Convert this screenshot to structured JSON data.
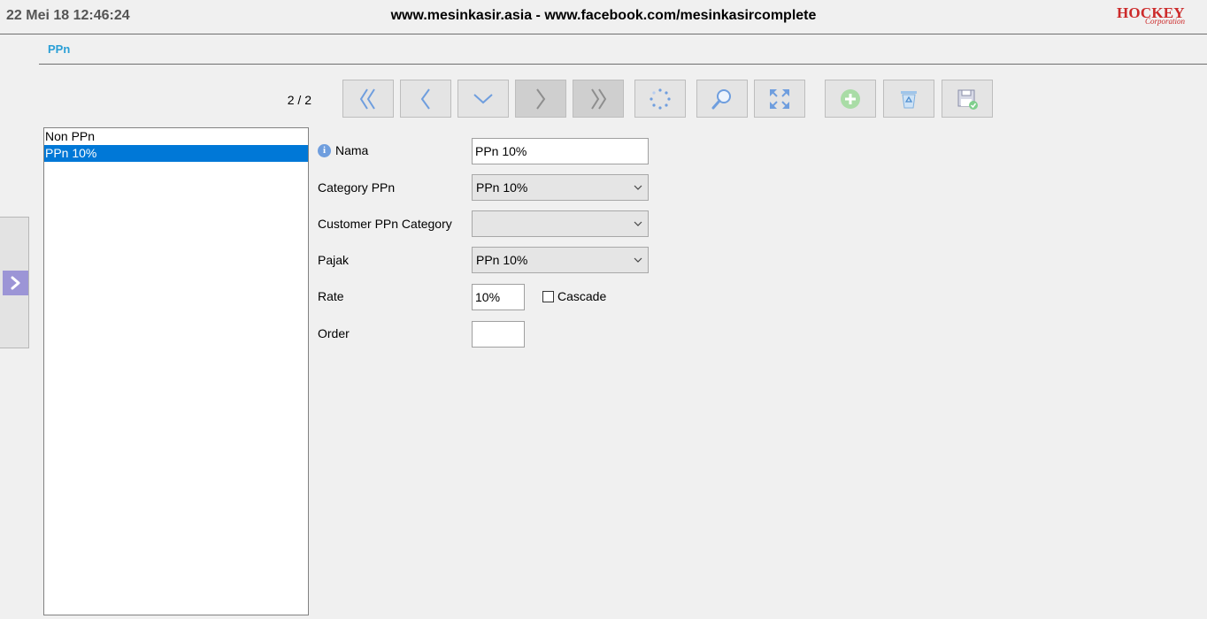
{
  "header": {
    "datetime": "22 Mei 18 12:46:24",
    "site": "www.mesinkasir.asia - www.facebook.com/mesinkasircomplete",
    "brand_name": "HOCKEY",
    "brand_sub": "Corporation"
  },
  "tab": {
    "title": "PPn"
  },
  "toolbar": {
    "record_counter": "2 / 2",
    "buttons": [
      {
        "name": "first-record",
        "icon": "double-chevron-left-icon",
        "enabled": true
      },
      {
        "name": "previous-record",
        "icon": "chevron-left-icon",
        "enabled": true
      },
      {
        "name": "next-down",
        "icon": "chevron-down-icon",
        "enabled": true
      },
      {
        "name": "next-record",
        "icon": "chevron-right-icon",
        "enabled": false
      },
      {
        "name": "last-record",
        "icon": "double-chevron-right-icon",
        "enabled": false
      },
      {
        "name": "refresh",
        "icon": "spinner-icon",
        "enabled": true
      },
      {
        "name": "search",
        "icon": "magnifier-icon",
        "enabled": true
      },
      {
        "name": "expand",
        "icon": "expand-arrows-icon",
        "enabled": true
      },
      {
        "name": "add",
        "icon": "plus-circle-icon",
        "enabled": true
      },
      {
        "name": "delete",
        "icon": "recycle-bin-icon",
        "enabled": true
      },
      {
        "name": "save",
        "icon": "floppy-disk-icon",
        "enabled": true
      }
    ]
  },
  "list": {
    "items": [
      "Non PPn",
      "PPn 10%"
    ],
    "selected_index": 1
  },
  "form": {
    "nama": {
      "label": "Nama",
      "value": "PPn 10%"
    },
    "category": {
      "label": "Category PPn",
      "value": "PPn 10%"
    },
    "customer_category": {
      "label": "Customer PPn Category",
      "value": ""
    },
    "pajak": {
      "label": "Pajak",
      "value": "PPn 10%"
    },
    "rate": {
      "label": "Rate",
      "value": "10%"
    },
    "cascade": {
      "label": "Cascade",
      "checked": false
    },
    "order": {
      "label": "Order",
      "value": ""
    }
  },
  "colors": {
    "accent": "#2a9fd6",
    "selection": "#0078d7",
    "brand": "#cc2a2a",
    "side_toggle": "#9c95d6"
  }
}
